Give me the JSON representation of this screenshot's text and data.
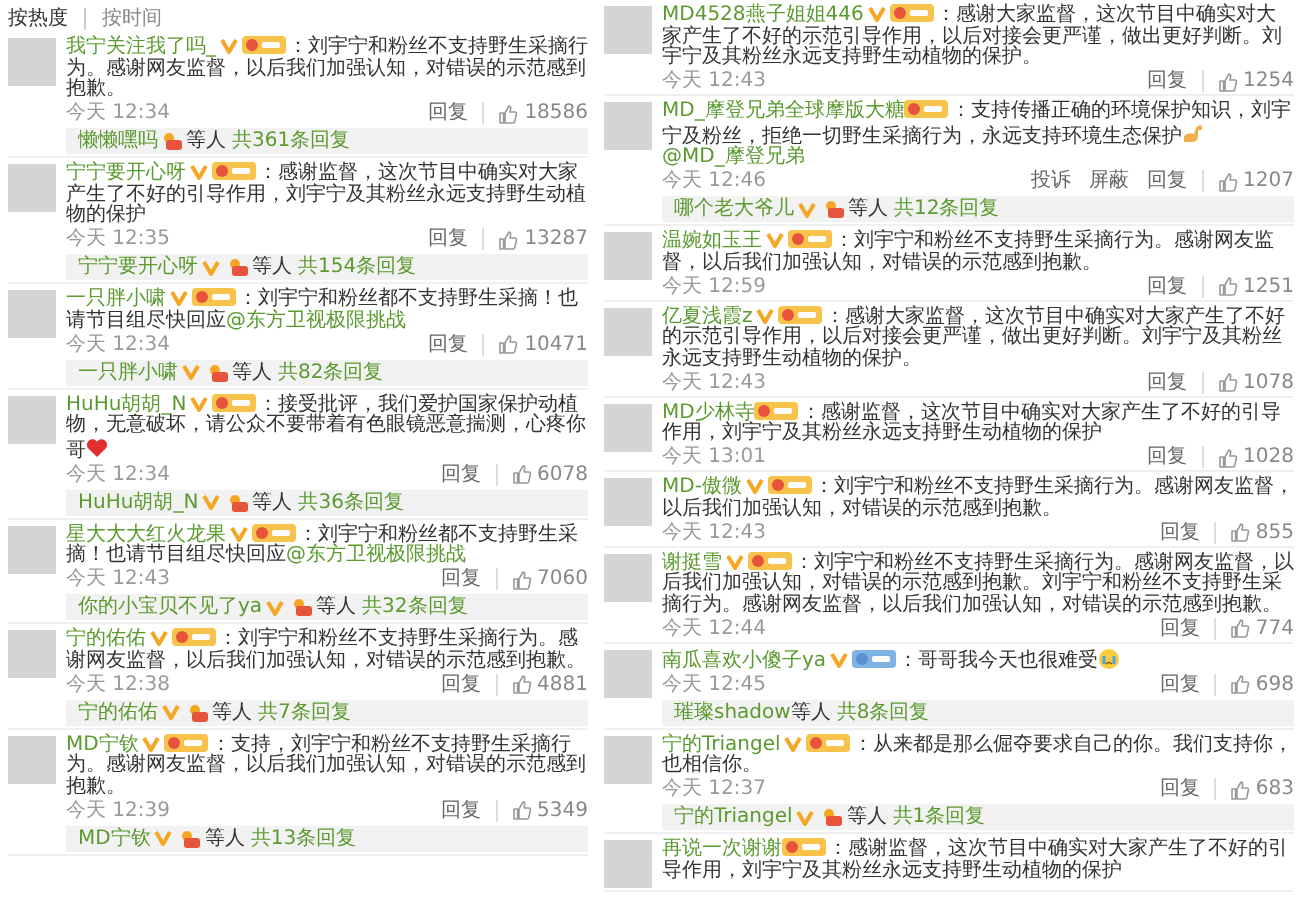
{
  "tabs": [
    {
      "label": "按热度",
      "selected": true
    },
    {
      "label": "按时间",
      "selected": false
    }
  ],
  "columns": [
    {
      "comments": [
        {
          "name": "我宁关注我了吗_",
          "verified": true,
          "blue_badge": false,
          "segments": [
            {
              "kind": "text",
              "text": "：刘宇宁和粉丝不支持野生采摘行为。感谢网友监督，以后我们加强认知，对错误的示范感到抱歉。"
            }
          ],
          "time": "今天 12:34",
          "actions": [
            "回复"
          ],
          "likes": "18586",
          "reply": {
            "name": "懒懒嘿吗",
            "verified": false,
            "fan_icon": true,
            "suffix": "等人",
            "count": "共361条回复"
          }
        },
        {
          "name": "宁宁要开心呀",
          "verified": true,
          "blue_badge": false,
          "segments": [
            {
              "kind": "text",
              "text": "：感谢监督，这次节目中确实对大家产生了不好的引导作用，刘宇宁及其粉丝永远支持野生动植物的保护"
            }
          ],
          "time": "今天 12:35",
          "actions": [
            "回复"
          ],
          "likes": "13287",
          "reply": {
            "name": "宁宁要开心呀",
            "verified": true,
            "fan_icon": true,
            "suffix": "等人",
            "count": "共154条回复"
          }
        },
        {
          "name": "一只胖小啸",
          "verified": true,
          "blue_badge": false,
          "segments": [
            {
              "kind": "text",
              "text": "：刘宇宁和粉丝都不支持野生采摘！也请节目组尽快回应"
            },
            {
              "kind": "mention",
              "text": "@东方卫视极限挑战"
            }
          ],
          "time": "今天 12:34",
          "actions": [
            "回复"
          ],
          "likes": "10471",
          "reply": {
            "name": "一只胖小啸",
            "verified": true,
            "fan_icon": true,
            "suffix": "等人",
            "count": "共82条回复"
          }
        },
        {
          "name": "HuHu胡胡_N",
          "verified": true,
          "blue_badge": false,
          "segments": [
            {
              "kind": "text",
              "text": "：接受批评，我们爱护国家保护动植物，无意破坏，请公众不要带着有色眼镜恶意揣测，心疼你哥"
            },
            {
              "kind": "heart"
            }
          ],
          "time": "今天 12:34",
          "actions": [
            "回复"
          ],
          "likes": "6078",
          "reply": {
            "name": "HuHu胡胡_N",
            "verified": true,
            "fan_icon": true,
            "suffix": "等人",
            "count": "共36条回复"
          }
        },
        {
          "name": "星大大大红火龙果",
          "verified": true,
          "blue_badge": false,
          "segments": [
            {
              "kind": "text",
              "text": "：刘宇宁和粉丝都不支持野生采摘！也请节目组尽快回应"
            },
            {
              "kind": "mention",
              "text": "@东方卫视极限挑战"
            }
          ],
          "time": "今天 12:43",
          "actions": [
            "回复"
          ],
          "likes": "7060",
          "reply": {
            "name": "你的小宝贝不见了ya",
            "verified": true,
            "fan_icon": true,
            "suffix": "等人",
            "count": "共32条回复"
          }
        },
        {
          "name": "宁的佑佑",
          "verified": true,
          "blue_badge": false,
          "segments": [
            {
              "kind": "text",
              "text": "：刘宇宁和粉丝不支持野生采摘行为。感谢网友监督，以后我们加强认知，对错误的示范感到抱歉。"
            }
          ],
          "time": "今天 12:38",
          "actions": [
            "回复"
          ],
          "likes": "4881",
          "reply": {
            "name": "宁的佑佑",
            "verified": true,
            "fan_icon": true,
            "suffix": "等人",
            "count": "共7条回复"
          }
        },
        {
          "name": "MD宁钦",
          "verified": true,
          "blue_badge": false,
          "segments": [
            {
              "kind": "text",
              "text": "：支持，刘宇宁和粉丝不支持野生采摘行为。感谢网友监督，以后我们加强认知，对错误的示范感到抱歉。"
            }
          ],
          "time": "今天 12:39",
          "actions": [
            "回复"
          ],
          "likes": "5349",
          "reply": {
            "name": "MD宁钦",
            "verified": true,
            "fan_icon": true,
            "suffix": "等人",
            "count": "共13条回复"
          }
        }
      ]
    },
    {
      "comments": [
        {
          "name": "MD4528燕子姐姐446",
          "verified": true,
          "blue_badge": false,
          "segments": [
            {
              "kind": "text",
              "text": "：感谢大家监督，这次节目中确实对大家产生了不好的示范引导作用，以后对接会更严谨，做出更好判断。刘宇宁及其粉丝永远支持野生动植物的保护。"
            }
          ],
          "time": "今天 12:43",
          "actions": [
            "回复"
          ],
          "likes": "1254"
        },
        {
          "name": "MD_摩登兄弟全球摩版大糖",
          "verified": false,
          "blue_badge": false,
          "segments": [
            {
              "kind": "text",
              "text": "：支持传播正确的环境保护知识，刘宇宁及粉丝，拒绝一切野生采摘行为，永远支持环境生态保护"
            },
            {
              "kind": "arm"
            },
            {
              "kind": "mention",
              "text": "@MD_摩登兄弟"
            }
          ],
          "time": "今天 12:46",
          "actions": [
            "投诉",
            "屏蔽",
            "回复"
          ],
          "likes": "1207",
          "reply": {
            "name": "哪个老大爷儿",
            "verified": true,
            "fan_icon": true,
            "suffix": "等人",
            "count": "共12条回复"
          }
        },
        {
          "name": "温婉如玉王",
          "verified": true,
          "blue_badge": false,
          "segments": [
            {
              "kind": "text",
              "text": "：刘宇宁和粉丝不支持野生采摘行为。感谢网友监督，以后我们加强认知，对错误的示范感到抱歉。"
            }
          ],
          "time": "今天 12:59",
          "actions": [
            "回复"
          ],
          "likes": "1251"
        },
        {
          "name": "亿夏浅霞z",
          "verified": true,
          "blue_badge": false,
          "segments": [
            {
              "kind": "text",
              "text": "：感谢大家监督，这次节目中确实对大家产生了不好的示范引导作用，以后对接会更严谨，做出更好判断。刘宇宁及其粉丝永远支持野生动植物的保护。"
            }
          ],
          "time": "今天 12:43",
          "actions": [
            "回复"
          ],
          "likes": "1078"
        },
        {
          "name": "MD少林寺",
          "verified": false,
          "blue_badge": false,
          "segments": [
            {
              "kind": "text",
              "text": "：感谢监督，这次节目中确实对大家产生了不好的引导作用，刘宇宁及其粉丝永远支持野生动植物的保护"
            }
          ],
          "time": "今天 13:01",
          "actions": [
            "回复"
          ],
          "likes": "1028"
        },
        {
          "name": "MD-傲微",
          "verified": true,
          "blue_badge": false,
          "segments": [
            {
              "kind": "text",
              "text": "：刘宇宁和粉丝不支持野生采摘行为。感谢网友监督，以后我们加强认知，对错误的示范感到抱歉。"
            }
          ],
          "time": "今天 12:43",
          "actions": [
            "回复"
          ],
          "likes": "855"
        },
        {
          "name": "谢挺雪",
          "verified": true,
          "blue_badge": false,
          "segments": [
            {
              "kind": "text",
              "text": "：刘宇宁和粉丝不支持野生采摘行为。感谢网友监督，以后我们加强认知，对错误的示范感到抱歉。刘宇宁和粉丝不支持野生采摘行为。感谢网友监督，以后我们加强认知，对错误的示范感到抱歉。"
            }
          ],
          "time": "今天 12:44",
          "actions": [
            "回复"
          ],
          "likes": "774"
        },
        {
          "name": "南瓜喜欢小傻子ya",
          "verified": true,
          "blue_badge": true,
          "segments": [
            {
              "kind": "text",
              "text": "：哥哥我今天也很难受"
            },
            {
              "kind": "crying"
            }
          ],
          "time": "今天 12:45",
          "actions": [
            "回复"
          ],
          "likes": "698",
          "reply": {
            "name": "璀璨shadow",
            "verified": false,
            "fan_icon": false,
            "suffix": "等人",
            "count": "共8条回复"
          }
        },
        {
          "name": "宁的Triangel",
          "verified": true,
          "blue_badge": false,
          "segments": [
            {
              "kind": "text",
              "text": "：从来都是那么倔夺要求自己的你。我们支持你，也相信你。"
            }
          ],
          "time": "今天 12:37",
          "actions": [
            "回复"
          ],
          "likes": "683",
          "reply": {
            "name": "宁的Triangel",
            "verified": true,
            "fan_icon": true,
            "suffix": "等人",
            "count": "共1条回复"
          }
        },
        {
          "name": "再说一次谢谢",
          "verified": false,
          "blue_badge": false,
          "segments": [
            {
              "kind": "text",
              "text": "：感谢监督，这次节目中确实对大家产生了不好的引导作用，刘宇宁及其粉丝永远支持野生动植物的保护"
            }
          ]
        }
      ]
    }
  ]
}
